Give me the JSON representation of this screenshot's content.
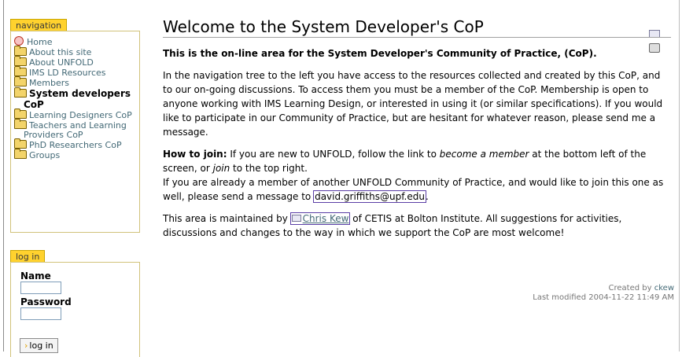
{
  "navigation": {
    "title": "navigation",
    "items": [
      {
        "label": "Home",
        "icon": "home-icon"
      },
      {
        "label": "About this site",
        "icon": "folder-icon"
      },
      {
        "label": "About UNFOLD",
        "icon": "folder-icon"
      },
      {
        "label": "IMS LD Resources",
        "icon": "folder-icon"
      },
      {
        "label": "Members",
        "icon": "folder-icon"
      },
      {
        "label": "System developers CoP",
        "icon": "folder-icon",
        "current": true
      },
      {
        "label": "Learning Designers CoP",
        "icon": "folder-icon"
      },
      {
        "label": "Teachers and Learning Providers CoP",
        "icon": "folder-icon"
      },
      {
        "label": "PhD Researchers CoP",
        "icon": "folder-icon"
      },
      {
        "label": "Groups",
        "icon": "folder-icon"
      }
    ]
  },
  "login": {
    "title": "log in",
    "name_label": "Name",
    "password_label": "Password",
    "button_label": "log in"
  },
  "page": {
    "title": "Welcome to the System Developer's CoP",
    "lead": "This is the on-line area for the System Developer's Community of Practice, (CoP).",
    "para1": "In the navigation tree to the left you have access to the resources collected and created by this CoP, and to our on-going discussions. To access them you must be a member of the CoP. Membership is open to anyone working with IMS Learning Design, or interested in using it (or similar specifications). If you would like to participate in our Community of Practice, but are hesitant for whatever reason, please send me a message.",
    "howto_label": "How to join:",
    "howto_a": " If you are new to UNFOLD, follow the link to ",
    "howto_em1": "become a member",
    "howto_b": " at the bottom left of the screen, or ",
    "howto_em2": "join",
    "howto_c": " to the top right.",
    "howto_2": "If you are already a member of another UNFOLD Community of Practice, and would like to join this one as well, please send a message to ",
    "email": "david.griffiths@upf.edu",
    "howto_end": ".",
    "maint_a": "This area is maintained by ",
    "maint_person": "Chris Kew",
    "maint_b": " of CETIS at Bolton Institute. All suggestions for activities, discussions and changes to the way in which we support the CoP are most welcome!",
    "created_by_label": "Created by ",
    "created_by": "ckew",
    "modified": "Last modified 2004-11-22 11:49 AM"
  }
}
